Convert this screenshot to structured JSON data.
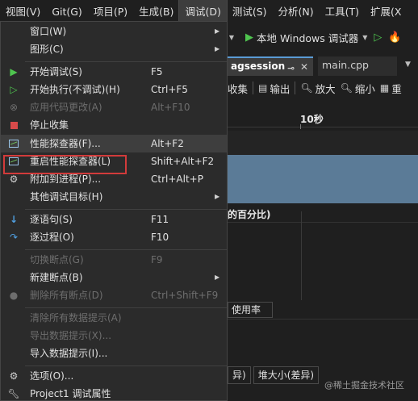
{
  "menubar": {
    "items": [
      "视图(V)",
      "Git(G)",
      "项目(P)",
      "生成(B)",
      "调试(D)",
      "测试(S)",
      "分析(N)",
      "工具(T)",
      "扩展(X"
    ]
  },
  "toolbar": {
    "debugger_label": "本地 Windows 调试器"
  },
  "tabs": {
    "active": "agsession",
    "inactive": "main.cpp"
  },
  "session_toolbar": {
    "collect": "收集",
    "output": "输出",
    "zoom_in": "放大",
    "zoom_out": "缩小",
    "trailing": "重"
  },
  "timeline": {
    "ruler_label": "10秒",
    "percent_heading": "的百分比)",
    "usage_tab": "使用率",
    "bottom_tab_1": "异)",
    "bottom_tab_2": "堆大小(差异)"
  },
  "watermark": "@稀土掘金技术社区",
  "debug_menu": {
    "window": "窗口(W)",
    "graphics": "图形(C)",
    "start_debugging": "开始调试(S)",
    "start_debugging_shortcut": "F5",
    "start_without_debugging": "开始执行(不调试)(H)",
    "start_without_debugging_shortcut": "Ctrl+F5",
    "apply_code_changes": "应用代码更改(A)",
    "apply_code_changes_shortcut": "Alt+F10",
    "stop_collection": "停止收集",
    "performance_profiler": "性能探查器(F)...",
    "performance_profiler_shortcut": "Alt+F2",
    "relaunch_profiler": "重启性能探查器(L)",
    "relaunch_profiler_shortcut": "Shift+Alt+F2",
    "attach_to_process": "附加到进程(P)...",
    "attach_to_process_shortcut": "Ctrl+Alt+P",
    "other_debug_targets": "其他调试目标(H)",
    "step_into": "逐语句(S)",
    "step_into_shortcut": "F11",
    "step_over": "逐过程(O)",
    "step_over_shortcut": "F10",
    "toggle_breakpoint": "切换断点(G)",
    "toggle_breakpoint_shortcut": "F9",
    "new_breakpoint": "新建断点(B)",
    "delete_all_breakpoints": "删除所有断点(D)",
    "delete_all_breakpoints_shortcut": "Ctrl+Shift+F9",
    "clear_all_datatips": "清除所有数据提示(A)",
    "export_datatips": "导出数据提示(X)...",
    "import_datatips": "导入数据提示(I)...",
    "options": "选项(O)...",
    "project_properties": "Project1 调试属性"
  },
  "icons": {
    "start": "play-icon",
    "start_no_debug": "play-outline-icon",
    "stop": "stop-icon",
    "profiler": "performance-chart-icon",
    "relaunch": "relaunch-chart-icon",
    "attach": "attach-process-icon",
    "step_into": "step-into-icon",
    "step_over": "step-over-icon",
    "delete_bp": "delete-breakpoints-icon",
    "options": "gear-icon"
  },
  "colors": {
    "menu_bg": "#2b2b2b",
    "highlight_border": "#d23b3b",
    "graph_fill": "#5b7b97",
    "play_green": "#4fc54f"
  }
}
